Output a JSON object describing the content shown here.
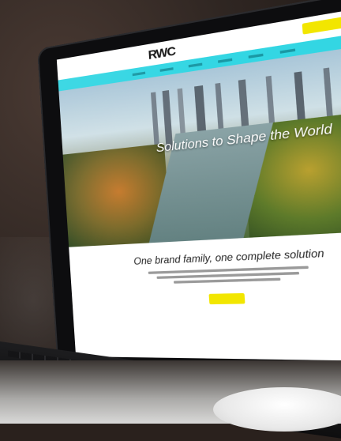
{
  "scene": {
    "site": {
      "logo": "RWC",
      "hero_title": "Solutions to Shape the World",
      "section_heading": "One brand family, one complete solution"
    },
    "colors": {
      "nav": "#33d6e3",
      "cta": "#f2e600"
    }
  }
}
